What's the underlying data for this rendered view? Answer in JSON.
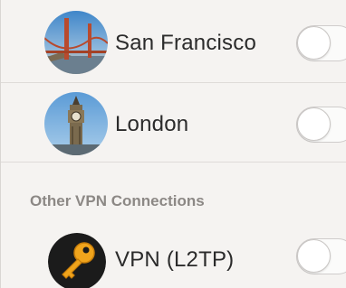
{
  "connections": [
    {
      "label": "San Francisco",
      "icon": "golden-gate-bridge-icon",
      "enabled": false
    },
    {
      "label": "London",
      "icon": "big-ben-icon",
      "enabled": false
    }
  ],
  "other_section": {
    "title": "Other VPN Connections",
    "items": [
      {
        "label": "VPN (L2TP)",
        "icon": "key-icon",
        "enabled": false
      }
    ]
  },
  "colors": {
    "background": "#f5f3f1",
    "text": "#2b2b2b",
    "section_header": "#8c8885",
    "key_gold": "#f0a41c"
  }
}
